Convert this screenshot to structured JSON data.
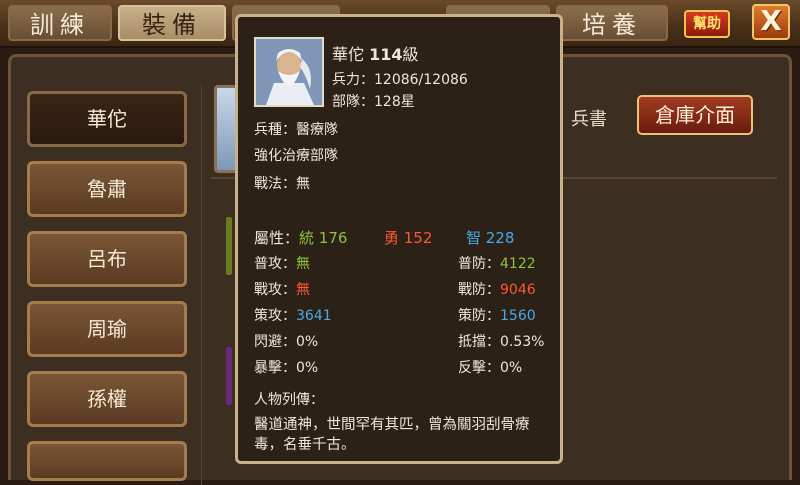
{
  "tabs": [
    "訓練",
    "裝備",
    "",
    "",
    "培養"
  ],
  "help_label": "幫助",
  "close_label": "X",
  "heroes": [
    "華佗",
    "魯肅",
    "呂布",
    "周瑜",
    "孫權"
  ],
  "warehouse_button": "倉庫介面",
  "partial_label": "兵書",
  "card": {
    "name": "華佗",
    "level_num": "114",
    "level_unit": "級",
    "troops_label": "兵力：",
    "troops_value": "12086/12086",
    "unit_label": "部隊：",
    "unit_value": "128星",
    "troop_type": "兵種：醫療隊",
    "skill_desc": "強化治療部隊",
    "tactic": "戰法：無",
    "attr_label": "屬性：",
    "attr_lead": "統 176",
    "attr_brave": "勇 152",
    "attr_int": "智 228",
    "stats_left": [
      {
        "label": "普攻：",
        "value": "無",
        "color": "#8fc23c"
      },
      {
        "label": "戰攻：",
        "value": "無",
        "color": "#ff5733"
      },
      {
        "label": "策攻：",
        "value": "3641",
        "color": "#49a9e6"
      },
      {
        "label": "閃避：",
        "value": "0%",
        "color": "#efe6d8"
      },
      {
        "label": "暴擊：",
        "value": "0%",
        "color": "#efe6d8"
      }
    ],
    "stats_right": [
      {
        "label": "普防：",
        "value": "4122",
        "color": "#8fc23c"
      },
      {
        "label": "戰防：",
        "value": "9046",
        "color": "#ff5733"
      },
      {
        "label": "策防：",
        "value": "1560",
        "color": "#49a9e6"
      },
      {
        "label": "抵擋：",
        "value": "0.53%",
        "color": "#efe6d8"
      },
      {
        "label": "反擊：",
        "value": "0%",
        "color": "#efe6d8"
      }
    ],
    "bio_label": "人物列傳：",
    "bio_text": "醫道通神，世間罕有其匹，曾為關羽刮骨療毒，名垂千古。"
  }
}
